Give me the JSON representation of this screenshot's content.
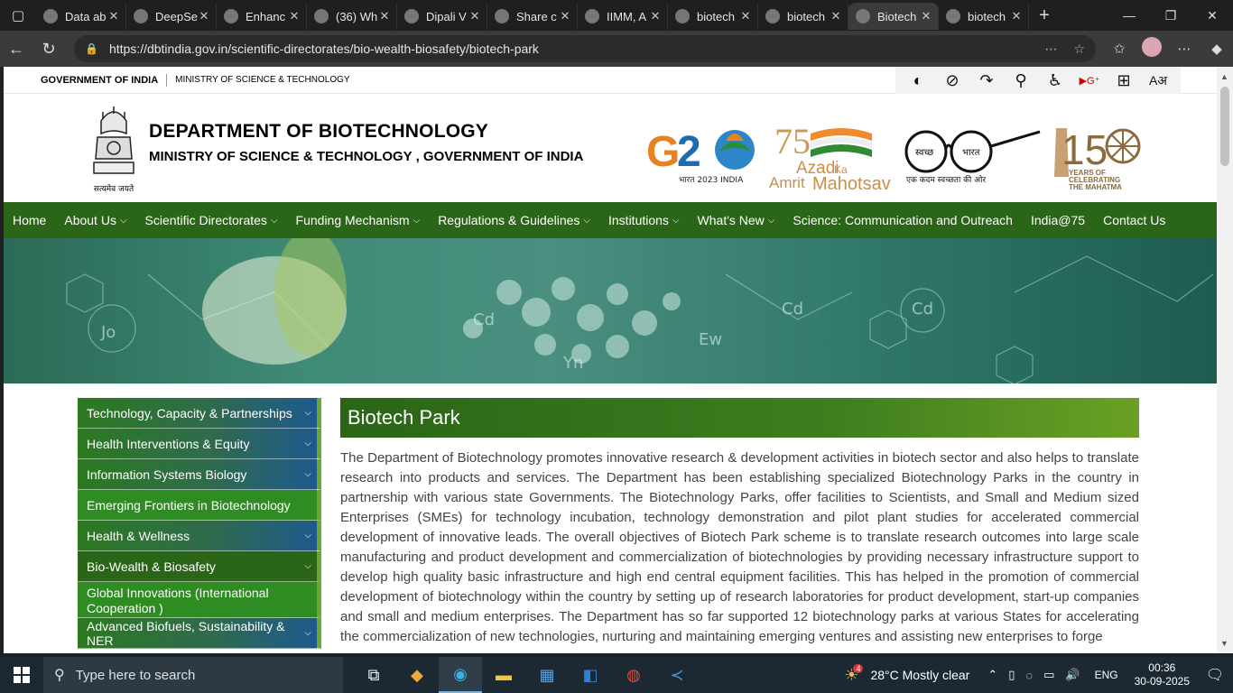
{
  "browser": {
    "tabs": [
      {
        "title": "Data ab",
        "icon": "chat-icon"
      },
      {
        "title": "DeepSe",
        "icon": "deepseek-icon"
      },
      {
        "title": "Enhanc",
        "icon": "deepseek-icon"
      },
      {
        "title": "(36) Wh",
        "icon": "whatsapp-icon"
      },
      {
        "title": "Dipali V",
        "icon": "globe-icon"
      },
      {
        "title": "Share c",
        "icon": "globe-icon"
      },
      {
        "title": "IIMM, A",
        "icon": "globe-icon"
      },
      {
        "title": "biotech",
        "icon": "search-icon"
      },
      {
        "title": "biotech",
        "icon": "globe-icon"
      },
      {
        "title": "Biotech",
        "icon": "page-icon",
        "active": true
      },
      {
        "title": "biotech",
        "icon": "globe-icon"
      }
    ],
    "url": "https://dbtindia.gov.in/scientific-directorates/bio-wealth-biosafety/biotech-park"
  },
  "gov_strip": {
    "gov": "GOVERNMENT OF INDIA",
    "ministry": "MINISTRY OF SCIENCE & TECHNOLOGY"
  },
  "header": {
    "dept": "DEPARTMENT OF BIOTECHNOLOGY",
    "ministry": "MINISTRY OF SCIENCE & TECHNOLOGY , GOVERNMENT OF INDIA",
    "emblem_caption": "सत्यमेव जयते",
    "g20_caption": "भारत 2023 INDIA",
    "azadi": [
      "Azadi",
      "Ka",
      "Amrit",
      "Mahotsav"
    ],
    "swachh": [
      "स्वच्छ",
      "भारत",
      "एक कदम स्वच्छता की ओर"
    ],
    "mahatma": [
      "YEARS OF",
      "CELEBRATING",
      "THE MAHATMA"
    ]
  },
  "nav": [
    {
      "label": "Home",
      "dropdown": false
    },
    {
      "label": "About Us",
      "dropdown": true
    },
    {
      "label": "Scientific Directorates",
      "dropdown": true
    },
    {
      "label": "Funding Mechanism",
      "dropdown": true
    },
    {
      "label": "Regulations & Guidelines",
      "dropdown": true
    },
    {
      "label": "Institutions",
      "dropdown": true
    },
    {
      "label": "What's New",
      "dropdown": true
    },
    {
      "label": "Science: Communication and Outreach",
      "dropdown": false
    },
    {
      "label": "India@75",
      "dropdown": false
    },
    {
      "label": "Contact Us",
      "dropdown": false
    }
  ],
  "sidebar": [
    {
      "label": "Technology, Capacity & Partnerships",
      "chevron": true
    },
    {
      "label": "Health Interventions & Equity",
      "chevron": true
    },
    {
      "label": "Information Systems Biology",
      "chevron": true
    },
    {
      "label": "Emerging Frontiers in Biotechnology",
      "chevron": false
    },
    {
      "label": "Health & Wellness",
      "chevron": true
    },
    {
      "label": "Bio-Wealth & Biosafety",
      "chevron": true,
      "active": true
    },
    {
      "label": "Global Innovations (International Cooperation )",
      "chevron": false
    },
    {
      "label": "Advanced Biofuels, Sustainability & NER",
      "chevron": true
    }
  ],
  "main": {
    "title": "Biotech Park",
    "body": "The Department of Biotechnology promotes innovative research & development activities in biotech sector and also helps to translate research into products and services. The Department has been establishing specialized Biotechnology Parks in the country in partnership with various state Governments. The Biotechnology Parks, offer facilities to Scientists, and Small and Medium sized Enterprises (SMEs) for technology incubation, technology demonstration and pilot plant studies for accelerated commercial development of innovative leads. The overall objectives of Biotech Park scheme is to translate research outcomes into large scale manufacturing and product development and commercialization of biotechnologies by providing necessary infrastructure support to develop high quality basic infrastructure and high end central equipment facilities. This has helped in the promotion of commercial development of biotechnology within the country by setting up of research laboratories for product development, start-up companies and small and medium enterprises. The Department has so far supported 12 biotechnology parks at various States for accelerating the commercialization of new technologies, nurturing and maintaining emerging ventures and assisting new enterprises to forge"
  },
  "taskbar": {
    "search_placeholder": "Type here to search",
    "weather": "28°C  Mostly clear",
    "weather_badge": "4",
    "lang": "ENG",
    "time": "00:36",
    "date": "30-09-2025"
  }
}
